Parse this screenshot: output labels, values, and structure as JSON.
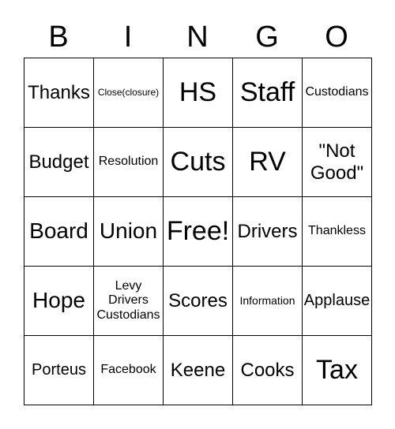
{
  "header": [
    "B",
    "I",
    "N",
    "G",
    "O"
  ],
  "cells": [
    [
      "Thanks",
      "Close(closure)",
      "HS",
      "Staff",
      "Custodians"
    ],
    [
      "Budget",
      "Resolution",
      "Cuts",
      "RV",
      "\"Not\nGood\""
    ],
    [
      "Board",
      "Union",
      "Free!",
      "Drivers",
      "Thankless"
    ],
    [
      "Hope",
      "Levy\nDrivers\nCustodians",
      "Scores",
      "Information",
      "Applause"
    ],
    [
      "Porteus",
      "Facebook",
      "Keene",
      "Cooks",
      "Tax"
    ]
  ]
}
